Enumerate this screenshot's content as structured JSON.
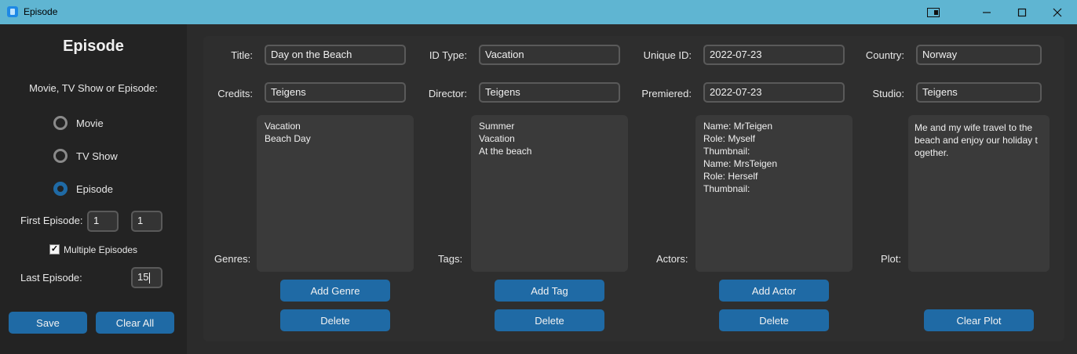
{
  "window": {
    "title": "Episode"
  },
  "sidebar": {
    "heading": "Episode",
    "type_question": "Movie, TV Show or Episode:",
    "options": [
      "Movie",
      "TV Show",
      "Episode"
    ],
    "selected": "Episode",
    "first_episode_label": "First Episode:",
    "first_episode_season": "1",
    "first_episode_number": "1",
    "multiple_episodes_label": "Multiple Episodes",
    "multiple_episodes_checked": true,
    "last_episode_label": "Last Episode:",
    "last_episode_value": "15",
    "save_label": "Save",
    "clear_all_label": "Clear All"
  },
  "form": {
    "title_label": "Title:",
    "title_value": "Day on the Beach",
    "id_type_label": "ID Type:",
    "id_type_value": "Vacation",
    "unique_id_label": "Unique ID:",
    "unique_id_value": "2022-07-23",
    "country_label": "Country:",
    "country_value": "Norway",
    "credits_label": "Credits:",
    "credits_value": "Teigens",
    "director_label": "Director:",
    "director_value": "Teigens",
    "premiered_label": "Premiered:",
    "premiered_value": "2022-07-23",
    "studio_label": "Studio:",
    "studio_value": "Teigens"
  },
  "genres": {
    "label": "Genres:",
    "items": [
      "Vacation",
      "Beach Day"
    ],
    "add_label": "Add Genre",
    "delete_label": "Delete"
  },
  "tags": {
    "label": "Tags:",
    "items": [
      "Summer",
      "Vacation",
      "At the beach"
    ],
    "add_label": "Add Tag",
    "delete_label": "Delete"
  },
  "actors": {
    "label": "Actors:",
    "items": [
      "Name: MrTeigen",
      "Role: Myself",
      "Thumbnail:",
      "Name: MrsTeigen",
      "Role: Herself",
      "Thumbnail:"
    ],
    "add_label": "Add Actor",
    "delete_label": "Delete"
  },
  "plot": {
    "label": "Plot:",
    "lines": [
      "Me and my wife travel to the",
      "beach and enjoy our holiday t",
      "ogether."
    ],
    "clear_label": "Clear Plot"
  },
  "colors": {
    "accent": "#1f6aa5",
    "titlebar": "#5fb5d2"
  }
}
